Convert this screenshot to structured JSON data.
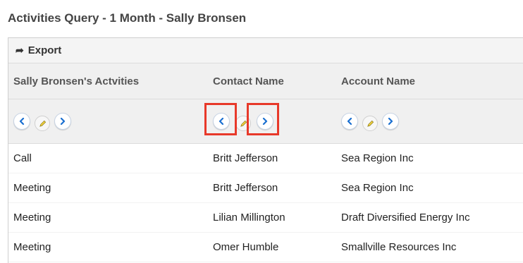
{
  "page": {
    "title": "Activities Query - 1 Month - Sally Bronsen"
  },
  "toolbar": {
    "export_label": "Export"
  },
  "table": {
    "columns": [
      "Sally Bronsen's Actvities",
      "Contact Name",
      "Account Name"
    ],
    "rows": [
      [
        "Call",
        "Britt Jefferson",
        "Sea Region Inc"
      ],
      [
        "Meeting",
        "Britt Jefferson",
        "Sea Region Inc"
      ],
      [
        "Meeting",
        "Lilian Millington",
        "Draft Diversified Energy Inc"
      ],
      [
        "Meeting",
        "Omer Humble",
        "Smallville Resources Inc"
      ]
    ]
  },
  "colors": {
    "highlight": "#e8392a",
    "nav_accent": "#1a6fd1"
  },
  "icons": {
    "export": "export-arrow-icon",
    "left": "chevron-left-icon",
    "right": "chevron-right-icon",
    "edit": "pencil-icon"
  }
}
